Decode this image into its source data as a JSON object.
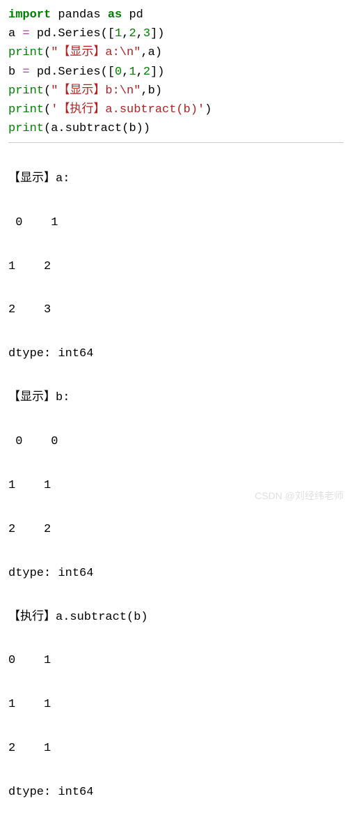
{
  "code": {
    "line1": {
      "import": "import",
      "module": "pandas",
      "as": "as",
      "alias": "pd"
    },
    "line2": {
      "var": "a",
      "eq": " = ",
      "prefix": "pd.",
      "cls": "Series",
      "args": "([",
      "n1": "1",
      "c1": ",",
      "n2": "2",
      "c2": ",",
      "n3": "3",
      "close": "])"
    },
    "line3": {
      "print": "print",
      "open": "(",
      "str": "\"【显示】a:\\n\"",
      "comma": ",",
      "arg": "a",
      "close": ")"
    },
    "line4": {
      "var": "b",
      "eq": " = ",
      "prefix": "pd.",
      "cls": "Series",
      "args": "([",
      "n1": "0",
      "c1": ",",
      "n2": "1",
      "c2": ",",
      "n3": "2",
      "close": "])"
    },
    "line5": {
      "print": "print",
      "open": "(",
      "str": "\"【显示】b:\\n\"",
      "comma": ",",
      "arg": "b",
      "close": ")"
    },
    "line6": {
      "print": "print",
      "open": "(",
      "str": "'【执行】a.subtract(b)'",
      "close": ")"
    },
    "line7": {
      "print": "print",
      "open": "(",
      "arg1": "a.",
      "method": "subtract",
      "arg2": "(b)",
      "close": ")"
    }
  },
  "output": {
    "l1": "【显示】a:",
    "l2": " 0    1",
    "l3": "1    2",
    "l4": "2    3",
    "l5": "dtype: int64",
    "l6": "【显示】b:",
    "l7": " 0    0",
    "l8": "1    1",
    "l9": "2    2",
    "l10": "dtype: int64",
    "l11": "【执行】a.subtract(b)",
    "l12": "0    1",
    "l13": "1    1",
    "l14": "2    1",
    "l15": "dtype: int64"
  },
  "watermark": "CSDN @刘经纬老师"
}
